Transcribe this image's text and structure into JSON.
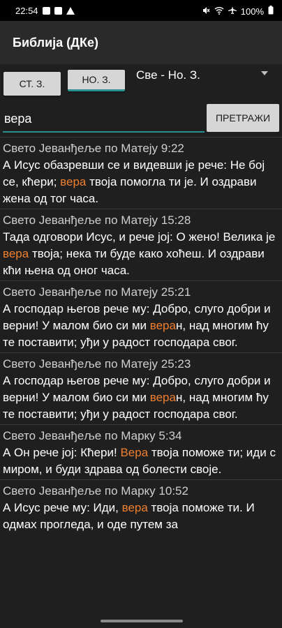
{
  "status_bar": {
    "time": "22:54",
    "battery": "100%",
    "left_icons": [
      "image-icon",
      "check-box-icon",
      "warning-icon"
    ],
    "right_icons": [
      "mute-icon",
      "wifi-icon",
      "airplane-icon",
      "battery-icon"
    ]
  },
  "app_bar": {
    "title": "Библија (ДКе)"
  },
  "tabs": [
    {
      "label": "СТ. З."
    },
    {
      "label": "НО. З."
    }
  ],
  "scope_select": {
    "value": "Све - Но. З."
  },
  "search": {
    "value": "вера",
    "button_label": "ПРЕТРАЖИ"
  },
  "colors": {
    "highlight": "#f07f2e",
    "accent": "#2a8f8f",
    "background": "#1f1f1f"
  },
  "results": [
    {
      "ref": "Свето Јеванђеље по Матеју 9:22",
      "before": "А Исус обазревши се и видевши је рече: Не бој се, кћери; ",
      "match": "вера",
      "after": " твоја помогла ти је. И оздрави жена од тог часа."
    },
    {
      "ref": "Свето Јеванђеље по Матеју 15:28",
      "before": "Тада одговори Исус, и рече јој: О жено! Велика је ",
      "match": "вера",
      "after": " твоја; нека ти буде како хоћеш. И оздрави кћи њена од оног часа."
    },
    {
      "ref": "Свето Јеванђеље по Матеју 25:21",
      "before": "А господар његов рече му: Добро, слуго добри и верни! У малом био си ми ",
      "match": "вера",
      "after": "н, над многим ћу те поставити; уђи у радост господара свог."
    },
    {
      "ref": "Свето Јеванђеље по Матеју 25:23",
      "before": "А господар његов рече му: Добро, слуго добри и верни! У малом био си ми ",
      "match": "вера",
      "after": "н, над многим ћу те поставити; уђи у радост господара свог."
    },
    {
      "ref": "Свето Јеванђеље по Марку 5:34",
      "before": "А Он рече јој: Кћери! ",
      "match": "Вера",
      "after": " твоја поможе ти; иди с миром, и буди здрава од болести своје."
    },
    {
      "ref": "Свето Јеванђеље по Марку 10:52",
      "before": "А Исус рече му: Иди, ",
      "match": "вера",
      "after": " твоја поможе ти. И одмах прогледа, и оде путем за"
    }
  ]
}
